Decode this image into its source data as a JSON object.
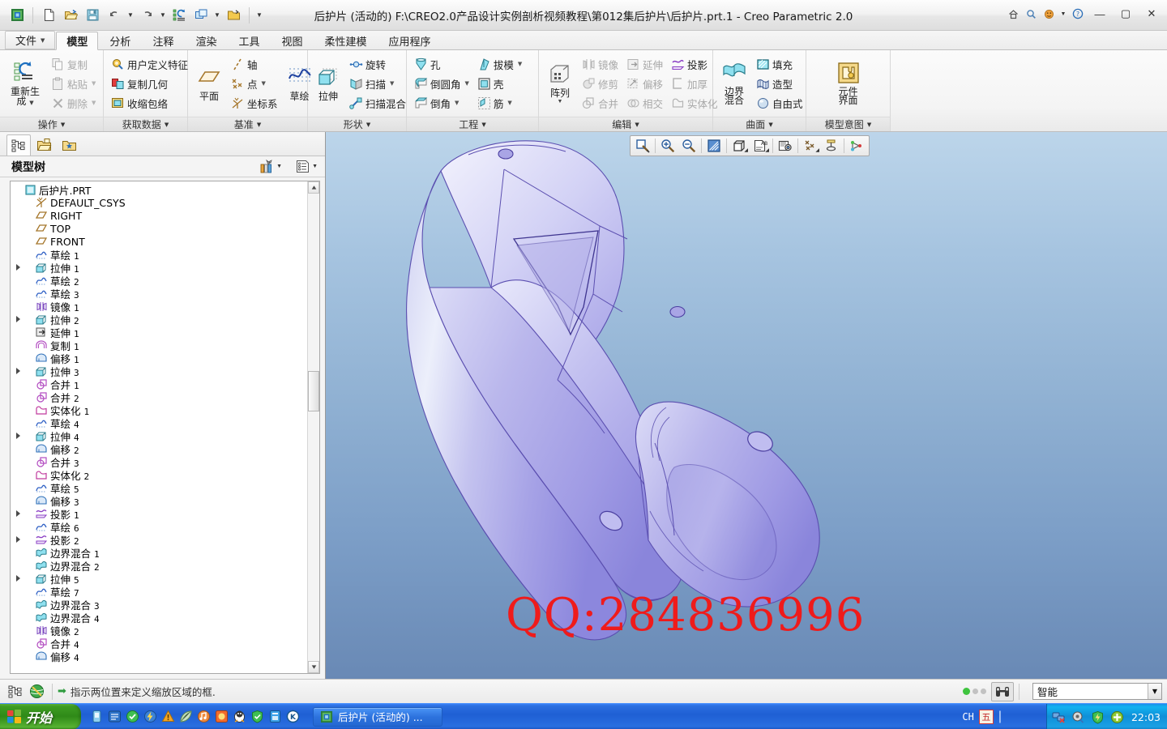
{
  "window": {
    "title": "后护片 (活动的) F:\\CREO2.0产品设计实例剖析视频教程\\第012集后护片\\后护片.prt.1 - Creo Parametric 2.0",
    "minimize": "—",
    "maximize": "▢",
    "close": "✕"
  },
  "quick_access": {
    "items": [
      {
        "name": "creo-logo-icon",
        "label": "Creo"
      },
      {
        "name": "new-icon",
        "label": "新建"
      },
      {
        "name": "open-icon",
        "label": "打开"
      },
      {
        "name": "save-icon",
        "label": "保存"
      },
      {
        "name": "undo-icon",
        "label": "撤消"
      },
      {
        "name": "redo-icon",
        "label": "重做"
      },
      {
        "name": "regenerate-icon",
        "label": "重新生成"
      },
      {
        "name": "window-icon",
        "label": "窗口"
      },
      {
        "name": "close-folder-icon",
        "label": "关闭"
      }
    ],
    "overflow": "▼"
  },
  "help_bar": {
    "items": [
      {
        "name": "home-icon",
        "label": "主页"
      },
      {
        "name": "search-icon",
        "label": "搜索"
      },
      {
        "name": "smiley-icon",
        "label": "反馈"
      },
      {
        "name": "help-icon",
        "label": "帮助"
      }
    ]
  },
  "tabs": [
    {
      "label": "文件",
      "caret": "▼",
      "active": false,
      "file": true
    },
    {
      "label": "模型",
      "active": true
    },
    {
      "label": "分析",
      "active": false
    },
    {
      "label": "注释",
      "active": false
    },
    {
      "label": "渲染",
      "active": false
    },
    {
      "label": "工具",
      "active": false
    },
    {
      "label": "视图",
      "active": false
    },
    {
      "label": "柔性建模",
      "active": false
    },
    {
      "label": "应用程序",
      "active": false
    }
  ],
  "ribbon": {
    "groups": [
      {
        "title": "操作",
        "caret": "▼",
        "big": {
          "label_line1": "重新生",
          "label_line2": "成",
          "caret": "▼",
          "icon": "regenerate-icon"
        },
        "small": [
          {
            "label": "复制",
            "icon": "copy-icon",
            "dim": true
          },
          {
            "label": "粘贴",
            "icon": "paste-icon",
            "caret": "▼",
            "dim": true
          },
          {
            "label": "删除",
            "icon": "delete-icon",
            "caret": "▼",
            "dim": true
          }
        ]
      },
      {
        "title": "获取数据",
        "caret": "▼",
        "small": [
          {
            "label": "用户定义特征",
            "icon": "udf-icon"
          },
          {
            "label": "复制几何",
            "icon": "copy-geom-icon"
          },
          {
            "label": "收缩包络",
            "icon": "shrinkwrap-icon"
          }
        ]
      },
      {
        "title": "基准",
        "caret": "▼",
        "big": {
          "label_line1": "平面",
          "label_line2": "",
          "icon": "datum-plane-icon"
        },
        "small": [
          {
            "label": "轴",
            "icon": "datum-axis-icon"
          },
          {
            "label": "点",
            "icon": "datum-point-icon",
            "caret": "▼"
          },
          {
            "label": "坐标系",
            "icon": "datum-csys-icon"
          }
        ],
        "big2": {
          "label_line1": "草绘",
          "label_line2": "",
          "icon": "sketch-icon"
        }
      },
      {
        "title": "形状",
        "caret": "▼",
        "big": {
          "label_line1": "拉伸",
          "label_line2": "",
          "icon": "extrude-icon"
        },
        "small": [
          {
            "label": "旋转",
            "icon": "revolve-icon"
          },
          {
            "label": "扫描",
            "icon": "sweep-icon",
            "caret": "▼"
          },
          {
            "label": "扫描混合",
            "icon": "swept-blend-icon"
          }
        ]
      },
      {
        "title": "工程",
        "caret": "▼",
        "small_col1": [
          {
            "label": "孔",
            "icon": "hole-icon"
          },
          {
            "label": "倒圆角",
            "icon": "round-icon",
            "caret": "▼"
          },
          {
            "label": "倒角",
            "icon": "chamfer-icon",
            "caret": "▼"
          }
        ],
        "small_col2": [
          {
            "label": "拔模",
            "icon": "draft-icon",
            "caret": "▼"
          },
          {
            "label": "壳",
            "icon": "shell-icon"
          },
          {
            "label": "筋",
            "icon": "rib-icon",
            "caret": "▼"
          }
        ]
      },
      {
        "title": "编辑",
        "caret": "▼",
        "big": {
          "label_line1": "阵列",
          "label_line2": "",
          "caret": "▼",
          "icon": "pattern-icon"
        },
        "small_col1": [
          {
            "label": "镜像",
            "icon": "mirror-icon",
            "dim": true
          },
          {
            "label": "修剪",
            "icon": "trim-icon",
            "dim": true
          },
          {
            "label": "合并",
            "icon": "merge-icon",
            "dim": true
          }
        ],
        "small_col2": [
          {
            "label": "延伸",
            "icon": "extend-icon",
            "dim": true
          },
          {
            "label": "偏移",
            "icon": "offset-icon",
            "dim": true
          },
          {
            "label": "相交",
            "icon": "intersect-icon",
            "dim": true
          }
        ],
        "small_col3": [
          {
            "label": "投影",
            "icon": "project-icon"
          },
          {
            "label": "加厚",
            "icon": "thicken-icon",
            "dim": true
          },
          {
            "label": "实体化",
            "icon": "solidify-icon",
            "dim": true
          }
        ]
      },
      {
        "title": "曲面",
        "caret": "▼",
        "big": {
          "label_line1": "边界",
          "label_line2": "混合",
          "icon": "boundary-blend-icon"
        },
        "small": [
          {
            "label": "填充",
            "icon": "fill-icon"
          },
          {
            "label": "造型",
            "icon": "style-icon"
          },
          {
            "label": "自由式",
            "icon": "freestyle-icon"
          }
        ]
      },
      {
        "title": "模型意图",
        "caret": "▼",
        "big": {
          "label_line1": "元件",
          "label_line2": "界面",
          "icon": "component-interface-icon"
        }
      }
    ]
  },
  "nav_panel": {
    "tabs": [
      {
        "name": "model-tree-tab",
        "label": "模型树",
        "active": true
      },
      {
        "name": "folder-browser-tab",
        "label": "文件夹浏览器",
        "active": false
      },
      {
        "name": "favorites-tab",
        "label": "收藏夹",
        "active": false
      }
    ],
    "tree_title": "模型树",
    "header_buttons": [
      {
        "name": "tree-filter-button",
        "label": "显示",
        "caret": "▼"
      },
      {
        "name": "tree-settings-button",
        "label": "设置",
        "caret": "▼"
      }
    ],
    "tree": [
      {
        "label": "后护片.PRT",
        "num": "",
        "icon": "part-icon",
        "depth": 0,
        "expander": false
      },
      {
        "label": "DEFAULT_CSYS",
        "num": "",
        "icon": "csys-icon",
        "depth": 1,
        "expander": false
      },
      {
        "label": "RIGHT",
        "num": "",
        "icon": "plane-icon",
        "depth": 1,
        "expander": false
      },
      {
        "label": "TOP",
        "num": "",
        "icon": "plane-icon",
        "depth": 1,
        "expander": false
      },
      {
        "label": "FRONT",
        "num": "",
        "icon": "plane-icon",
        "depth": 1,
        "expander": false
      },
      {
        "label": "草绘",
        "num": "1",
        "icon": "sketch-tree-icon",
        "depth": 1,
        "expander": false
      },
      {
        "label": "拉伸",
        "num": "1",
        "icon": "extrude-tree-icon",
        "depth": 1,
        "expander": true
      },
      {
        "label": "草绘",
        "num": "2",
        "icon": "sketch-tree-icon",
        "depth": 1,
        "expander": false
      },
      {
        "label": "草绘",
        "num": "3",
        "icon": "sketch-tree-icon",
        "depth": 1,
        "expander": false
      },
      {
        "label": "镜像",
        "num": "1",
        "icon": "mirror-tree-icon",
        "depth": 1,
        "expander": false
      },
      {
        "label": "拉伸",
        "num": "2",
        "icon": "extrude-tree-icon",
        "depth": 1,
        "expander": true
      },
      {
        "label": "延伸",
        "num": "1",
        "icon": "extend-tree-icon",
        "depth": 1,
        "expander": false
      },
      {
        "label": "复制",
        "num": "1",
        "icon": "copy-tree-icon",
        "depth": 1,
        "expander": false
      },
      {
        "label": "偏移",
        "num": "1",
        "icon": "offset-tree-icon",
        "depth": 1,
        "expander": false
      },
      {
        "label": "拉伸",
        "num": "3",
        "icon": "extrude-tree-icon",
        "depth": 1,
        "expander": true
      },
      {
        "label": "合并",
        "num": "1",
        "icon": "merge-tree-icon",
        "depth": 1,
        "expander": false
      },
      {
        "label": "合并",
        "num": "2",
        "icon": "merge-tree-icon",
        "depth": 1,
        "expander": false
      },
      {
        "label": "实体化",
        "num": "1",
        "icon": "solidify-tree-icon",
        "depth": 1,
        "expander": false
      },
      {
        "label": "草绘",
        "num": "4",
        "icon": "sketch-tree-icon",
        "depth": 1,
        "expander": false
      },
      {
        "label": "拉伸",
        "num": "4",
        "icon": "extrude-tree-icon",
        "depth": 1,
        "expander": true
      },
      {
        "label": "偏移",
        "num": "2",
        "icon": "offset-tree-icon",
        "depth": 1,
        "expander": false
      },
      {
        "label": "合并",
        "num": "3",
        "icon": "merge-tree-icon",
        "depth": 1,
        "expander": false
      },
      {
        "label": "实体化",
        "num": "2",
        "icon": "solidify-tree-icon",
        "depth": 1,
        "expander": false
      },
      {
        "label": "草绘",
        "num": "5",
        "icon": "sketch-tree-icon",
        "depth": 1,
        "expander": false
      },
      {
        "label": "偏移",
        "num": "3",
        "icon": "offset-tree-icon",
        "depth": 1,
        "expander": false
      },
      {
        "label": "投影",
        "num": "1",
        "icon": "project-tree-icon",
        "depth": 1,
        "expander": true
      },
      {
        "label": "草绘",
        "num": "6",
        "icon": "sketch-tree-icon",
        "depth": 1,
        "expander": false
      },
      {
        "label": "投影",
        "num": "2",
        "icon": "project-tree-icon",
        "depth": 1,
        "expander": true
      },
      {
        "label": "边界混合",
        "num": "1",
        "icon": "bblend-tree-icon",
        "depth": 1,
        "expander": false
      },
      {
        "label": "边界混合",
        "num": "2",
        "icon": "bblend-tree-icon",
        "depth": 1,
        "expander": false
      },
      {
        "label": "拉伸",
        "num": "5",
        "icon": "extrude-tree-icon",
        "depth": 1,
        "expander": true
      },
      {
        "label": "草绘",
        "num": "7",
        "icon": "sketch-tree-icon",
        "depth": 1,
        "expander": false
      },
      {
        "label": "边界混合",
        "num": "3",
        "icon": "bblend-tree-icon",
        "depth": 1,
        "expander": false
      },
      {
        "label": "边界混合",
        "num": "4",
        "icon": "bblend-tree-icon",
        "depth": 1,
        "expander": false
      },
      {
        "label": "镜像",
        "num": "2",
        "icon": "mirror-tree-icon",
        "depth": 1,
        "expander": false
      },
      {
        "label": "合并",
        "num": "4",
        "icon": "merge-tree-icon",
        "depth": 1,
        "expander": false
      },
      {
        "label": "偏移",
        "num": "4",
        "icon": "offset-tree-icon",
        "depth": 1,
        "expander": false
      }
    ]
  },
  "graphics": {
    "toolbar": [
      {
        "name": "zoom-to-fit-icon",
        "label": "重新调整"
      },
      {
        "name": "zoom-in-icon",
        "label": "放大"
      },
      {
        "name": "zoom-out-icon",
        "label": "缩小"
      },
      {
        "name": "repaint-icon",
        "label": "重画"
      },
      {
        "name": "display-style-icon",
        "label": "显示样式",
        "caret": "◢"
      },
      {
        "name": "annotation-display-icon",
        "label": "注释显示",
        "caret": "◢"
      },
      {
        "name": "saved-views-icon",
        "label": "已保存视图"
      },
      {
        "name": "datum-display-icon",
        "label": "基准显示",
        "caret": "◢"
      },
      {
        "name": "spin-center-icon",
        "label": "旋转中心"
      },
      {
        "name": "perspective-icon",
        "label": "透视图"
      }
    ],
    "watermark": "QQ:284836996",
    "watermark_color": "#ef1b1b",
    "background_top_color": "#bcd5ea",
    "background_bottom_color": "#6989b5",
    "model_color": "#b5b2e8"
  },
  "status_bar": {
    "left_buttons": [
      {
        "name": "model-tree-toggle",
        "label": "模型树"
      },
      {
        "name": "browser-toggle",
        "label": "浏览器"
      }
    ],
    "message_arrow": "➡",
    "message": "指示两位置来定义缩放区域的框.",
    "dots": [
      {
        "name": "status-dot-active",
        "color": "#3fc43f"
      },
      {
        "name": "status-dot-idle-1",
        "color": "#c2c2c2"
      },
      {
        "name": "status-dot-idle-2",
        "color": "#c2c2c2"
      }
    ],
    "search_button": {
      "name": "find-button",
      "label": "查找"
    },
    "selection_filter": {
      "value": "智能",
      "caret": "▼"
    }
  },
  "taskbar": {
    "start_label": "开始",
    "quick_launch": [
      {
        "name": "ql-media-icon",
        "label": "媒体"
      },
      {
        "name": "ql-browser-icon",
        "label": "浏览器"
      },
      {
        "name": "ql-green-icon",
        "label": "绿色软件"
      },
      {
        "name": "ql-thunder-icon",
        "label": "迅雷"
      },
      {
        "name": "ql-warning-icon",
        "label": "警告"
      },
      {
        "name": "ql-leaf-icon",
        "label": "叶子"
      },
      {
        "name": "ql-music-icon",
        "label": "音乐"
      },
      {
        "name": "ql-sun-icon",
        "label": "太阳"
      },
      {
        "name": "ql-qq-icon",
        "label": "QQ"
      },
      {
        "name": "ql-shield-icon",
        "label": "卫士"
      },
      {
        "name": "ql-blue-icon",
        "label": "蓝色应用"
      },
      {
        "name": "ql-k-icon",
        "label": "K"
      }
    ],
    "tasks": [
      {
        "name": "taskbar-item-creo",
        "label": "后护片 (活动的) ...",
        "icon": "creo-logo-icon",
        "active": true
      }
    ],
    "tray": {
      "lang_ime": "CH",
      "lang_box": "五",
      "icons": [
        {
          "name": "tray-network-icon",
          "label": "网络"
        },
        {
          "name": "tray-volume-icon",
          "label": "音量"
        },
        {
          "name": "tray-shield-icon",
          "label": "安全卫士"
        },
        {
          "name": "tray-plus-icon",
          "label": "管家"
        }
      ],
      "clock": "22:03"
    }
  }
}
